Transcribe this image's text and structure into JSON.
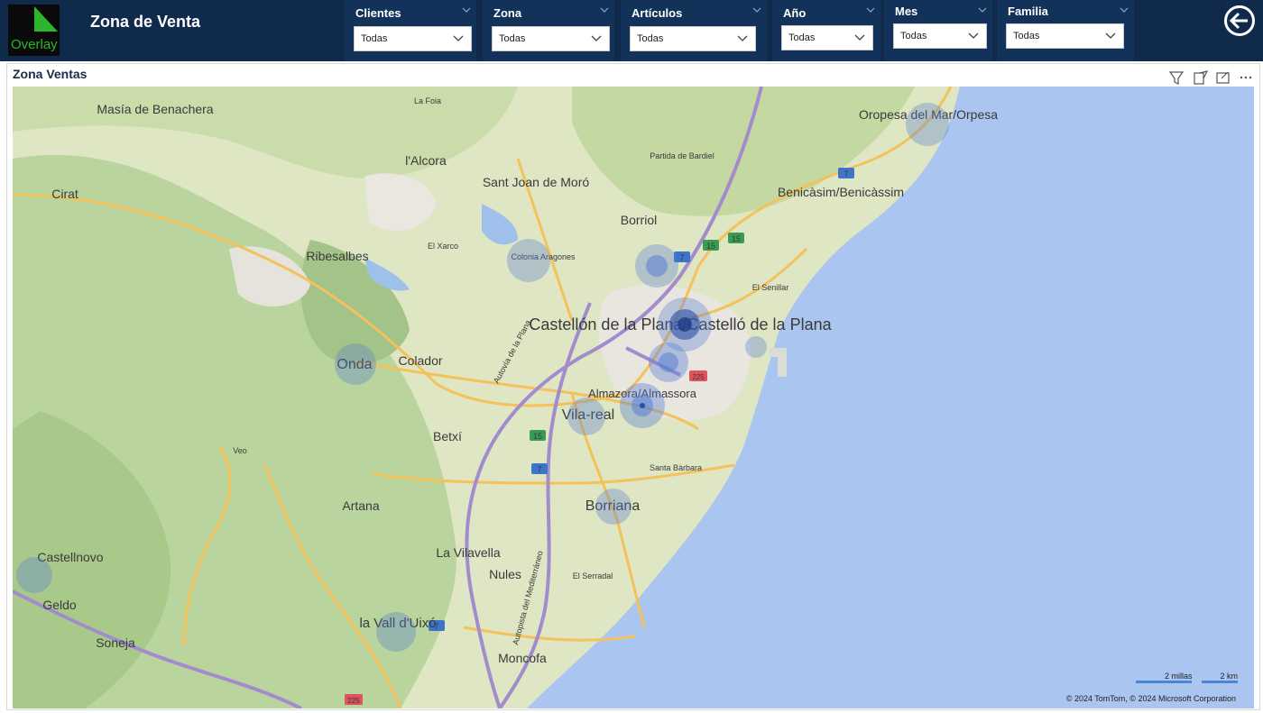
{
  "header": {
    "logo_text": "Overlay",
    "title": "Zona de Venta",
    "back_icon": "back-arrow-icon"
  },
  "slicers": [
    {
      "label": "Clientes",
      "value": "Todas"
    },
    {
      "label": "Zona",
      "value": "Todas"
    },
    {
      "label": "Artículos",
      "value": "Todas"
    },
    {
      "label": "Año",
      "value": "Todas"
    },
    {
      "label": "Mes",
      "value": "Todas"
    },
    {
      "label": "Familia",
      "value": "Todas"
    }
  ],
  "visual": {
    "title": "Zona Ventas",
    "toolbar_icons": [
      "filter-icon",
      "drill-icon",
      "focus-mode-icon",
      "more-options-icon"
    ]
  },
  "map": {
    "colors": {
      "land": "#dfe6c4",
      "green": "#b7d39a",
      "sea": "#a9c5f0",
      "road": "#f3c25b",
      "motorway": "#a38ccc",
      "bubble": "#5a7fd1"
    },
    "places": [
      "Masía de Benachera",
      "La Foia",
      "l'Alcora",
      "Sant Joan de Moró",
      "Partida de Bardiel",
      "Oropesa del Mar/Orpesa",
      "Cirat",
      "Borriol",
      "Benicàsim/Benicàssim",
      "El Xarco",
      "Colonia Aragones",
      "Ribesalbes",
      "El Senillar",
      "Castellón de la Plana/Castelló de la Plana",
      "Onda",
      "Colador",
      "Almazora/Almassora",
      "Vila-real",
      "Betxí",
      "Veo",
      "Santa Bàrbara",
      "Borriana",
      "Artana",
      "Castellnovo",
      "La Vilavella",
      "Nules",
      "El Serradal",
      "Geldo",
      "la Vall d'Uixó",
      "Soneja",
      "Moncofa",
      "Autovía de la Plana",
      "Autopista del Mediterráneo"
    ],
    "road_shields": [
      "7",
      "15",
      "15",
      "7",
      "225",
      "15",
      "7",
      "7",
      "225"
    ],
    "scale": {
      "miles": "2 millas",
      "km": "2 km"
    },
    "copyright": "© 2024 TomTom, © 2024 Microsoft Corporation"
  }
}
